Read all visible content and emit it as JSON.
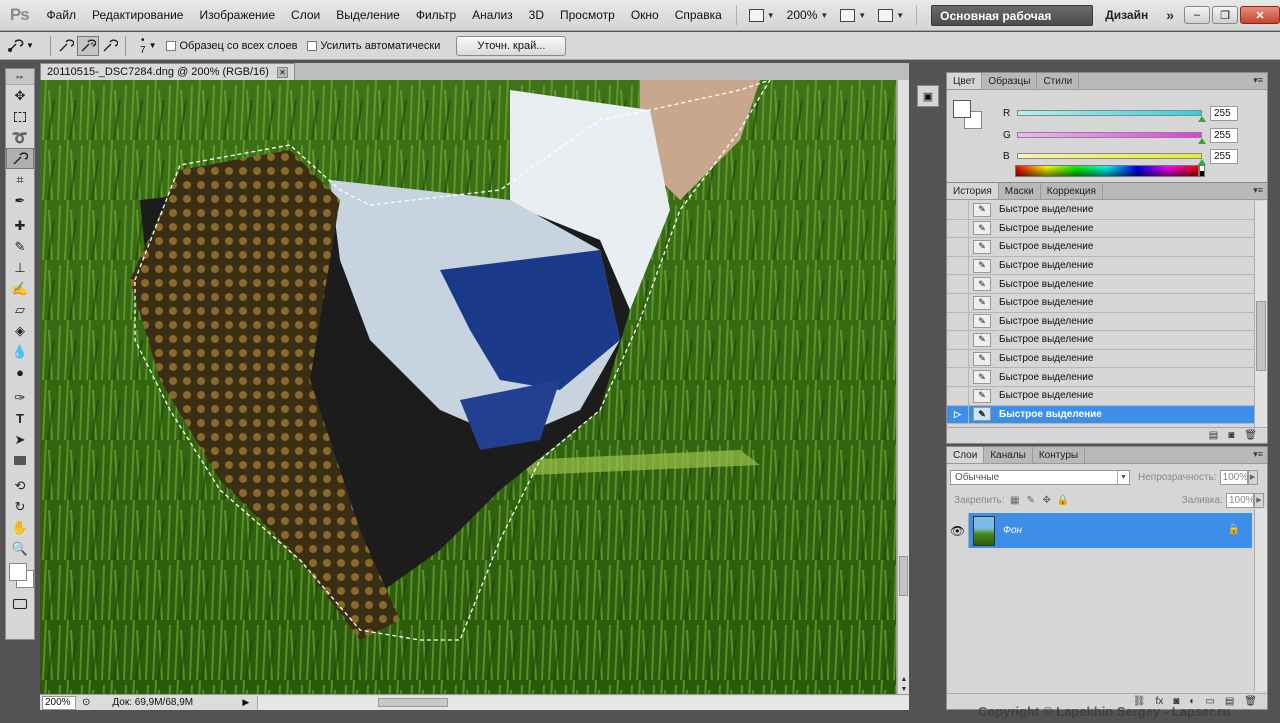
{
  "app": {
    "logo": "Ps"
  },
  "menu": [
    {
      "label": "Файл"
    },
    {
      "label": "Редактирование"
    },
    {
      "label": "Изображение"
    },
    {
      "label": "Слои"
    },
    {
      "label": "Выделение"
    },
    {
      "label": "Фильтр"
    },
    {
      "label": "Анализ"
    },
    {
      "label": "3D"
    },
    {
      "label": "Просмотр"
    },
    {
      "label": "Окно"
    },
    {
      "label": "Справка"
    }
  ],
  "menubar": {
    "zoom_level": "200%",
    "workspace": "Основная рабочая среда",
    "workspace_alt": "Дизайн",
    "more": "»"
  },
  "options": {
    "brush_size": "7",
    "sample_all_layers": "Образец со всех слоев",
    "auto_enhance": "Усилить автоматически",
    "refine_edge": "Уточн. край..."
  },
  "document": {
    "tab_title": "20110515-_DSC7284.dng @ 200% (RGB/16)",
    "zoom": "200%",
    "doc_size": "Док: 69,9M/68,9M"
  },
  "color_panel": {
    "tabs": [
      "Цвет",
      "Образцы",
      "Стили"
    ],
    "channels": [
      {
        "label": "R",
        "value": "255",
        "color": "#2fd0d8"
      },
      {
        "label": "G",
        "value": "255",
        "color": "#e23ce0"
      },
      {
        "label": "B",
        "value": "255",
        "color": "#e8e830"
      }
    ]
  },
  "history_panel": {
    "tabs": [
      "История",
      "Маски",
      "Коррекция"
    ],
    "items": [
      {
        "label": "Быстрое выделение"
      },
      {
        "label": "Быстрое выделение"
      },
      {
        "label": "Быстрое выделение"
      },
      {
        "label": "Быстрое выделение"
      },
      {
        "label": "Быстрое выделение"
      },
      {
        "label": "Быстрое выделение"
      },
      {
        "label": "Быстрое выделение"
      },
      {
        "label": "Быстрое выделение"
      },
      {
        "label": "Быстрое выделение"
      },
      {
        "label": "Быстрое выделение"
      },
      {
        "label": "Быстрое выделение"
      },
      {
        "label": "Быстрое выделение"
      }
    ],
    "active_index": 11
  },
  "layers_panel": {
    "tabs": [
      "Слои",
      "Каналы",
      "Контуры"
    ],
    "blend_mode": "Обычные",
    "opacity_label": "Непрозрачность:",
    "opacity": "100%",
    "lock_label": "Закрепить:",
    "fill_label": "Заливка:",
    "fill": "100%",
    "layer_name": "Фон"
  },
  "watermark": "Copyright © Lapekhin Sergey - Lapser.ru",
  "accent_color": "#3d8ee7"
}
